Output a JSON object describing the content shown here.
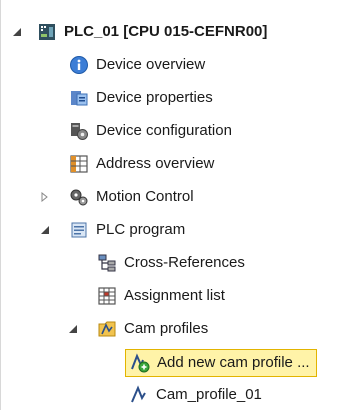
{
  "tree": {
    "root": {
      "label": "PLC_01 [CPU 015-CEFNR00]",
      "icon": "plc-cpu-icon"
    },
    "items": [
      {
        "label": "Device overview",
        "icon": "info-icon"
      },
      {
        "label": "Device properties",
        "icon": "properties-icon"
      },
      {
        "label": "Device configuration",
        "icon": "configuration-icon"
      },
      {
        "label": "Address overview",
        "icon": "address-table-icon"
      },
      {
        "label": "Motion Control",
        "icon": "motion-gears-icon"
      },
      {
        "label": "PLC program",
        "icon": "program-folder-icon"
      },
      {
        "label": "Cross-References",
        "icon": "cross-reference-icon"
      },
      {
        "label": "Assignment list",
        "icon": "assignment-list-icon"
      },
      {
        "label": "Cam profiles",
        "icon": "cam-folder-icon"
      },
      {
        "label": "Add new cam profile ...",
        "icon": "add-cam-profile-icon"
      },
      {
        "label": "Cam_profile_01",
        "icon": "cam-profile-icon"
      }
    ]
  },
  "colors": {
    "selection_fill": "#fff3a8",
    "selection_border": "#e2b400"
  }
}
